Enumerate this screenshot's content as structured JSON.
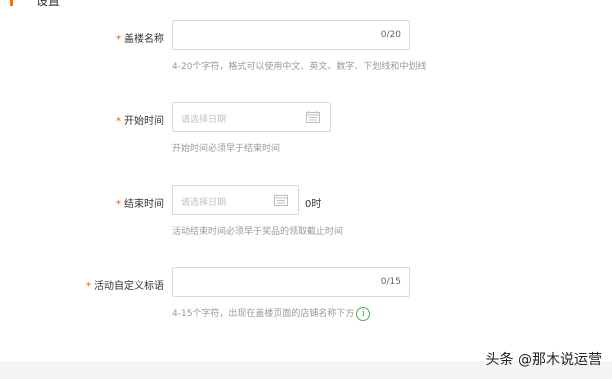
{
  "section": {
    "title": "设置"
  },
  "fields": {
    "name": {
      "required_mark": "*",
      "label": "盖楼名称",
      "counter": "0/20",
      "hint": "4-20个字符，格式可以使用中文、英文、数字、下划线和中划线"
    },
    "start": {
      "required_mark": "*",
      "label": "开始时间",
      "placeholder": "请选择日期",
      "hint": "开始时间必须早于结束时间"
    },
    "end": {
      "required_mark": "*",
      "label": "结束时间",
      "placeholder": "请选择日期",
      "suffix": "0时",
      "hint": "活动结束时间必须早于奖品的领取截止时间"
    },
    "custom": {
      "required_mark": "*",
      "label": "活动自定义标语",
      "counter": "0/15",
      "hint": "4-15个字符，出现在盖楼页面的店铺名称下方",
      "info_icon": "i"
    }
  },
  "watermark": "头条 @那木说运营",
  "colors": {
    "accent": "#ff6a00",
    "required": "#ff5000",
    "info": "#3fb34f"
  }
}
